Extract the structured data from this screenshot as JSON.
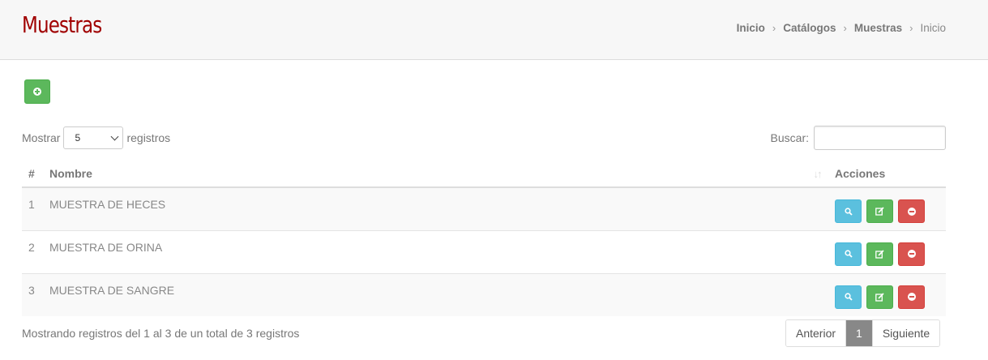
{
  "header": {
    "title": "Muestras",
    "breadcrumb": [
      "Inicio",
      "Catálogos",
      "Muestras",
      "Inicio"
    ],
    "separator": "›"
  },
  "toolbar": {
    "add_icon": "plus-circle-icon"
  },
  "length_control": {
    "label_before": "Mostrar",
    "selected": "5",
    "label_after": "registros"
  },
  "search": {
    "label": "Buscar:",
    "value": "",
    "placeholder": ""
  },
  "table": {
    "columns": [
      "#",
      "Nombre",
      "Acciones"
    ],
    "rows": [
      {
        "num": "1",
        "nombre": "MUESTRA DE HECES"
      },
      {
        "num": "2",
        "nombre": "MUESTRA DE ORINA"
      },
      {
        "num": "3",
        "nombre": "MUESTRA DE SANGRE"
      }
    ],
    "action_icons": [
      "search-icon",
      "edit-icon",
      "minus-circle-icon"
    ]
  },
  "info": "Mostrando registros del 1 al 3 de un total de 3 registros",
  "pagination": {
    "prev": "Anterior",
    "current": "1",
    "next": "Siguiente"
  },
  "colors": {
    "title": "#a00000",
    "success": "#5cb85c",
    "info": "#5bc0de",
    "danger": "#d9534f",
    "pager_active": "#888888"
  }
}
